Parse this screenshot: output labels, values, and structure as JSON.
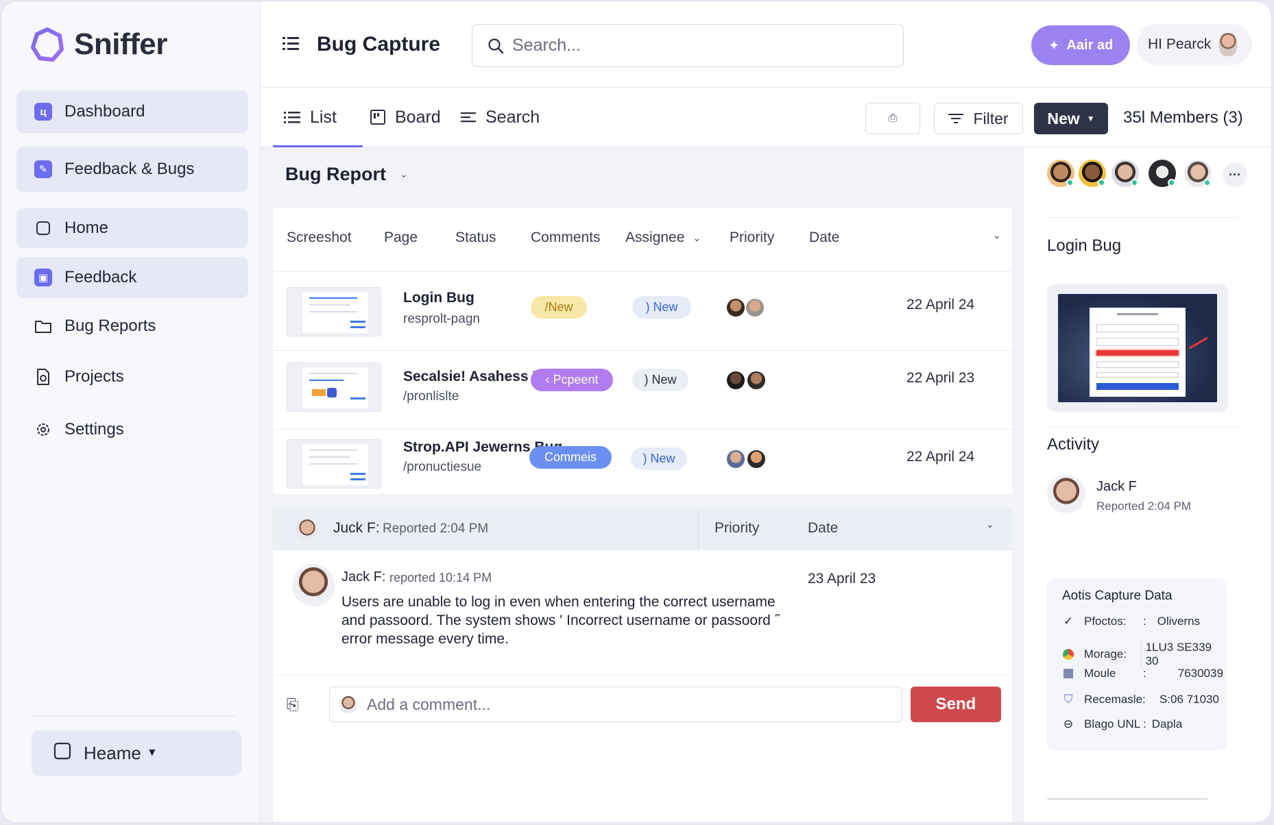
{
  "app": {
    "name": "Sniffer",
    "accent": "#6b6cf0"
  },
  "sidebar": {
    "items": [
      {
        "label": "Dashboard",
        "icon": "dashboard-icon"
      },
      {
        "label": "Feedback & Bugs",
        "icon": "edit-icon"
      },
      {
        "label": "Home",
        "icon": "square-icon"
      },
      {
        "label": "Feedback",
        "icon": "feedback-icon"
      },
      {
        "label": "Bug Reports",
        "icon": "folder-icon"
      },
      {
        "label": "Projects",
        "icon": "document-icon"
      },
      {
        "label": "Settings",
        "icon": "gear-icon"
      }
    ],
    "bottom": {
      "label": "Heame"
    }
  },
  "header": {
    "title": "Bug Capture",
    "search_placeholder": "Search...",
    "add_label": "Aair ad",
    "user_label": "HI Pearck"
  },
  "toolbar": {
    "tabs": [
      {
        "label": "List",
        "icon": "list-icon"
      },
      {
        "label": "Board",
        "icon": "board-icon"
      },
      {
        "label": "Search",
        "icon": "lines-icon"
      }
    ],
    "filter_label": "Filter",
    "new_label": "New",
    "members_label": "35l Members (3)"
  },
  "bug_report": {
    "title": "Bug Report",
    "columns": [
      "Screeshot",
      "Page",
      "Status",
      "Comments",
      "Assignee",
      "Priority",
      "Date"
    ],
    "rows": [
      {
        "title": "Login Bug",
        "page": "resprolt-pagn",
        "status": "/New",
        "status_color": "#f8e7a6",
        "status_text_color": "#b07a10",
        "priority": ") New",
        "date": "22 April 24"
      },
      {
        "title": "Secalsie! Asahess Bug",
        "page": "/pronlislte",
        "status": "‹ Pcpeent",
        "status_color": "#b07cf0",
        "status_text_color": "#ffffff",
        "priority": ") New",
        "date": "22 April 23"
      },
      {
        "title": "Strop.API Jewerns Bug",
        "page": "/pronuctiesue",
        "status": "Commeis",
        "status_color": "#6b8ff2",
        "status_text_color": "#ffffff",
        "priority": ") New",
        "date": "22 April 24"
      }
    ]
  },
  "comments": {
    "head": {
      "author": "Juck F",
      "meta": "Reported 2:04 PM",
      "col_priority": "Priority",
      "col_date": "Date"
    },
    "entry": {
      "author": "Jack F",
      "meta": "reported 10:14 PM",
      "date": "23 April 23",
      "text": "Users are unable to log in even when entering the correct username and passoord. The system shows ' Incorrect username or passoord ˝ error message every time."
    },
    "input_placeholder": "Add a comment...",
    "send_label": "Send"
  },
  "right_panel": {
    "bug_title": "Login Bug",
    "activity_title": "Activity",
    "activity_author": "Jack F",
    "activity_meta": "Reported 2:04 PM",
    "capture_title": "Aotis Capture Data",
    "capture_rows": [
      {
        "key": "Pfoctos:",
        "sep": ":",
        "value": "Oliverns",
        "icon": "check-icon"
      },
      {
        "key": "Morage:",
        "sep": "",
        "value": "1LU3 SE339 30",
        "icon": "chrome-icon"
      },
      {
        "key": "Moule",
        "sep": ":",
        "value": "7630039",
        "icon": "square-icon"
      },
      {
        "key": "Recemasle:",
        "sep": "",
        "value": "S:06 71030",
        "icon": "shield-icon"
      },
      {
        "key": "Blago UNL",
        "sep": ":",
        "value": "Dapla",
        "icon": "minus-circle-icon"
      }
    ]
  }
}
